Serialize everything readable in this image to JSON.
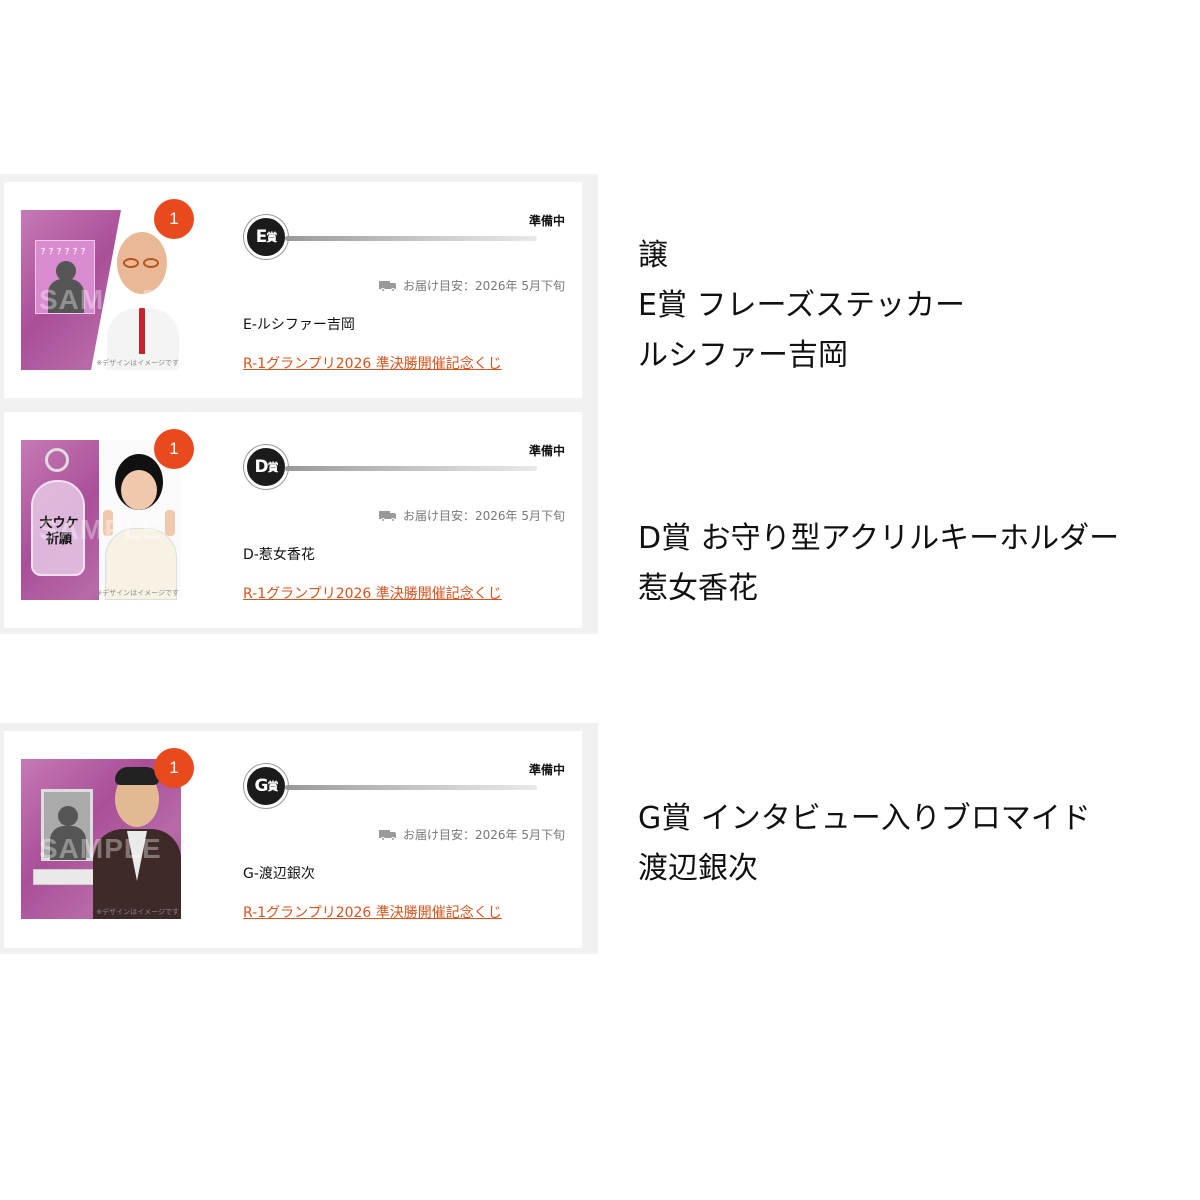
{
  "cards": [
    {
      "count": "1",
      "prize_mark": "E",
      "prize_mark_suffix": "賞",
      "status": "準備中",
      "delivery": "お届け目安：2026年  5月下旬",
      "item_name": "E-ルシファー吉岡",
      "lottery_link": "R-1グランプリ2026  準決勝開催記念くじ",
      "thumb_caption": "※デザインはイメージです",
      "thumb_sample": "SAMPLE",
      "thumb_sticker": "？？？？？？"
    },
    {
      "count": "1",
      "prize_mark": "D",
      "prize_mark_suffix": "賞",
      "status": "準備中",
      "delivery": "お届け目安：2026年  5月下旬",
      "item_name": "D-惹女香花",
      "lottery_link": "R-1グランプリ2026  準決勝開催記念くじ",
      "thumb_caption": "※デザインはイメージです",
      "thumb_sample": "SAMPLE",
      "thumb_charm": "大ウケ祈願"
    },
    {
      "count": "1",
      "prize_mark": "G",
      "prize_mark_suffix": "賞",
      "status": "準備中",
      "delivery": "お届け目安：2026年  5月下旬",
      "item_name": "G-渡辺銀次",
      "lottery_link": "R-1グランプリ2026  準決勝開催記念くじ",
      "thumb_caption": "※デザインはイメージです",
      "thumb_sample": "SAMPLE"
    }
  ],
  "right_texts": {
    "block1": [
      "譲",
      "E賞 フレーズステッカー",
      "ルシファー吉岡"
    ],
    "block2": [
      "D賞 お守り型アクリルキーホルダー",
      "惹女香花"
    ],
    "block3": [
      "G賞 インタビュー入りブロマイド",
      "渡辺銀次"
    ]
  },
  "colors": {
    "accent_orange": "#e8491d",
    "link_orange": "#d9531e",
    "thumb_purple": "#a94f98"
  },
  "icons": {
    "truck": "truck-icon"
  }
}
